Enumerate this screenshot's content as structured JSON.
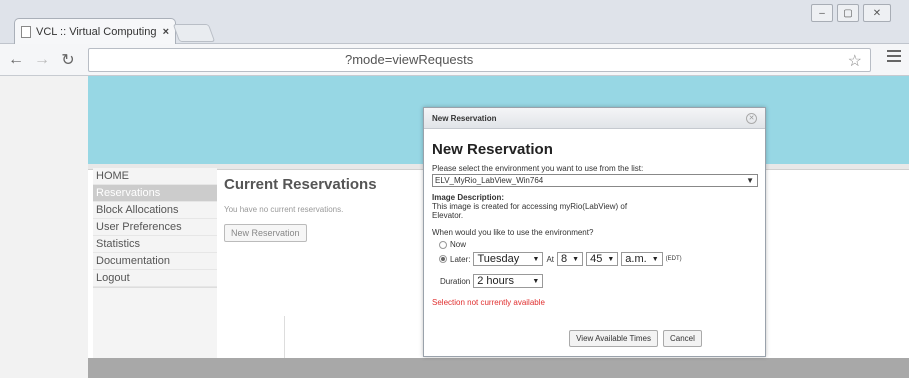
{
  "browser": {
    "tab_title": "VCL :: Virtual Computing L",
    "tab_close": "×",
    "url": "?mode=viewRequests",
    "window_controls": [
      "–",
      "▢",
      "✕"
    ]
  },
  "nav": {
    "items": [
      {
        "label": "HOME"
      },
      {
        "label": "Reservations"
      },
      {
        "label": "Block Allocations"
      },
      {
        "label": "User Preferences"
      },
      {
        "label": "Statistics"
      },
      {
        "label": "Documentation"
      },
      {
        "label": "Logout"
      }
    ],
    "active_index": 1
  },
  "main": {
    "title": "Current Reservations",
    "note": "You have no current reservations.",
    "new_button": "New Reservation"
  },
  "modal": {
    "header_title": "New Reservation",
    "heading": "New Reservation",
    "select_prompt": "Please select the environment you want to use from the list:",
    "environment": "ELV_MyRio_LabView_Win764",
    "desc_label": "Image Description:",
    "desc_text_1": "This image is created for accessing myRio(LabView) of",
    "desc_text_2": "Elevator.",
    "when_question": "When would you like to use the environment?",
    "now_label": "Now",
    "later_label": "Later:",
    "day": "Tuesday",
    "at_label": "At",
    "hour": "8",
    "minute": "45",
    "ampm": "a.m.",
    "timezone": "(EDT)",
    "duration_label": "Duration",
    "duration": "2 hours",
    "warning": "Selection not currently available",
    "view_button": "View Available Times",
    "cancel_button": "Cancel"
  }
}
